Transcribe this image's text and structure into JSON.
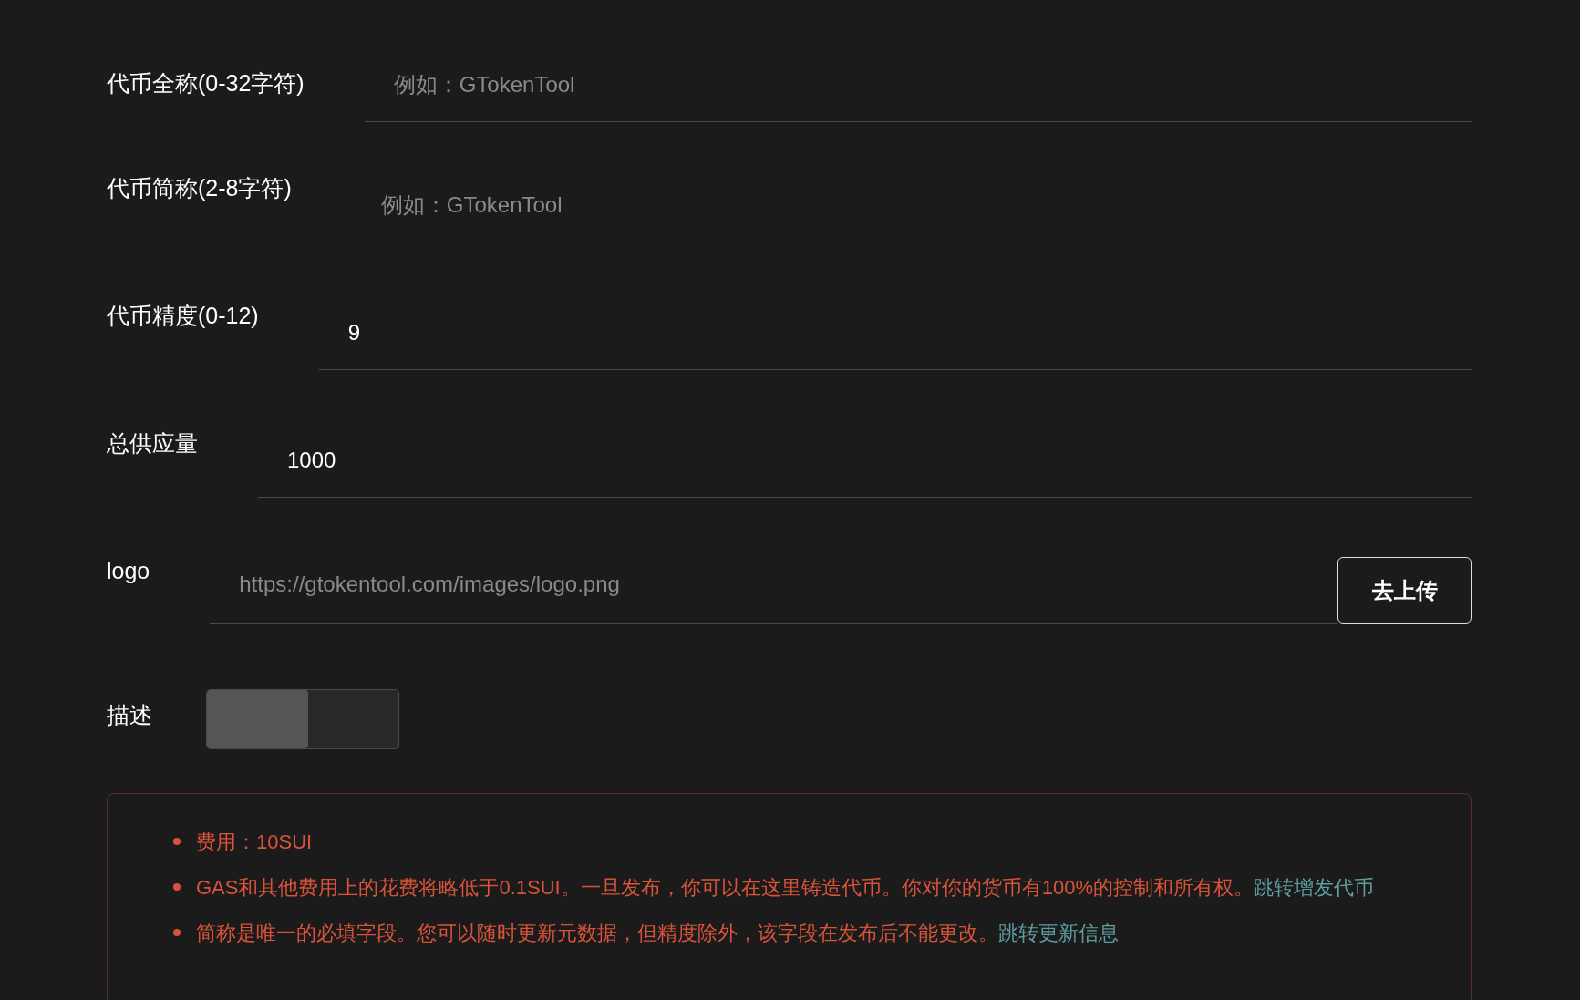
{
  "fields": [
    {
      "kind": "text",
      "label": "代币全称(0-32字符)",
      "placeholder": "例如：GTokenTool"
    },
    {
      "kind": "text",
      "label": "代币简称(2-8字符)",
      "placeholder": "例如：GTokenTool"
    },
    {
      "kind": "text",
      "label": "代币精度(0-12)",
      "value": "9"
    },
    {
      "kind": "text",
      "label": "总供应量",
      "value": "1000"
    },
    {
      "kind": "upload",
      "label": "logo",
      "placeholder": "https://gtokentool.com/images/logo.png",
      "button": "去上传"
    },
    {
      "kind": "toggle",
      "label": "描述",
      "on": false
    }
  ],
  "notes": [
    {
      "text": "费用：10SUI"
    },
    {
      "text": "GAS和其他费用上的花费将略低于0.1SUI。一旦发布，你可以在这里铸造代币。你对你的货币有100%的控制和所有权。",
      "link": "跳转增发代币"
    },
    {
      "text": "简称是唯一的必填字段。您可以随时更新元数据，但精度除外，该字段在发布后不能更改。",
      "link": "跳转更新信息"
    }
  ]
}
